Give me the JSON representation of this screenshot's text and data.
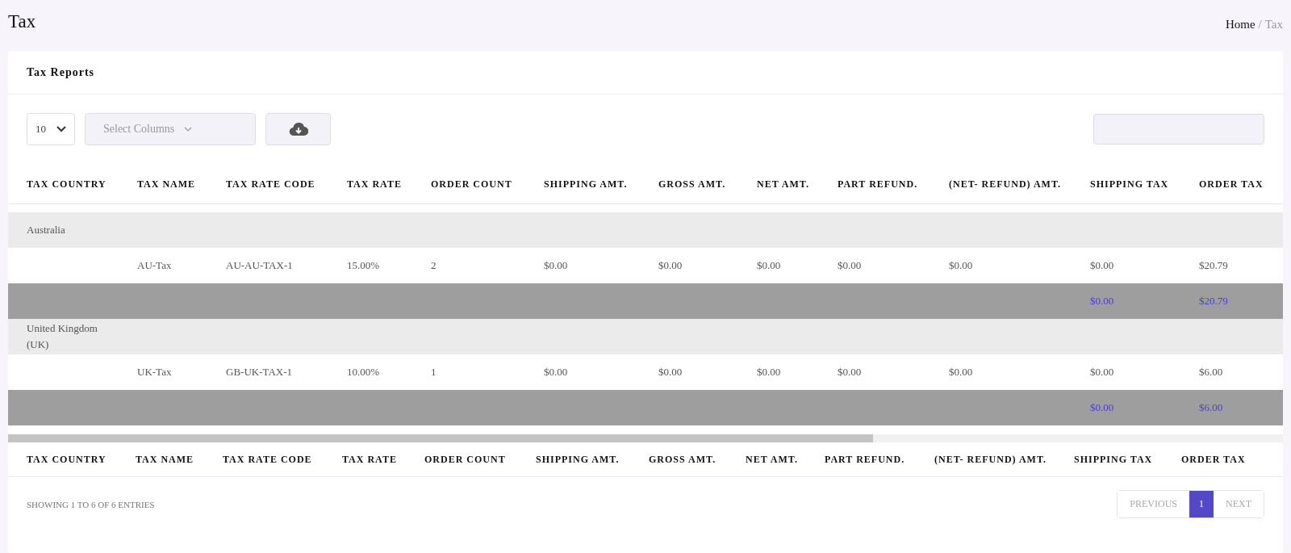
{
  "page": {
    "title": "Tax",
    "breadcrumb": {
      "items": [
        {
          "label": "Home",
          "current": false
        },
        {
          "label": "Tax",
          "current": true
        }
      ],
      "separator": "/"
    }
  },
  "card": {
    "title": "Tax Reports",
    "page_size": "10",
    "column_select": {
      "placeholder": "Select Columns"
    }
  },
  "table": {
    "columns": [
      "TAX COUNTRY",
      "TAX NAME",
      "TAX RATE CODE",
      "TAX RATE",
      "ORDER COUNT",
      "SHIPPING AMT.",
      "GROSS AMT.",
      "NET AMT.",
      "PART REFUND.",
      "(NET- REFUND) AMT.",
      "SHIPPING TAX",
      "ORDER TAX"
    ],
    "rows": [
      {
        "kind": "group",
        "cells": [
          "Australia"
        ]
      },
      {
        "kind": "detail",
        "cells": [
          "",
          "AU-Tax",
          "AU-AU-TAX-1",
          "15.00%",
          "2",
          "$0.00",
          "$0.00",
          "$0.00",
          "$0.00",
          "$0.00",
          "$0.00",
          "$20.79"
        ]
      },
      {
        "kind": "total",
        "cells": [
          "",
          "",
          "",
          "",
          "",
          "",
          "",
          "",
          "",
          "",
          "$0.00",
          "$20.79"
        ]
      },
      {
        "kind": "group",
        "cells": [
          "United Kingdom (UK)"
        ]
      },
      {
        "kind": "detail",
        "cells": [
          "",
          "UK-Tax",
          "GB-UK-TAX-1",
          "10.00%",
          "1",
          "$0.00",
          "$0.00",
          "$0.00",
          "$0.00",
          "$0.00",
          "$0.00",
          "$6.00"
        ]
      },
      {
        "kind": "total",
        "cells": [
          "",
          "",
          "",
          "",
          "",
          "",
          "",
          "",
          "",
          "",
          "$0.00",
          "$6.00"
        ]
      }
    ],
    "footer_columns": [
      "TAX COUNTRY",
      "TAX NAME",
      "TAX RATE CODE",
      "TAX RATE",
      "ORDER COUNT",
      "SHIPPING AMT.",
      "GROSS AMT.",
      "NET AMT.",
      "PART REFUND.",
      "(NET- REFUND) AMT.",
      "SHIPPING TAX",
      "ORDER TAX"
    ]
  },
  "info": "SHOWING 1 TO 6 OF 6 ENTRIES",
  "pagination": {
    "previous": {
      "label": "PREVIOUS",
      "disabled": true
    },
    "pages": [
      {
        "label": "1",
        "selected": true
      }
    ],
    "next": {
      "label": "NEXT",
      "disabled": true
    }
  }
}
